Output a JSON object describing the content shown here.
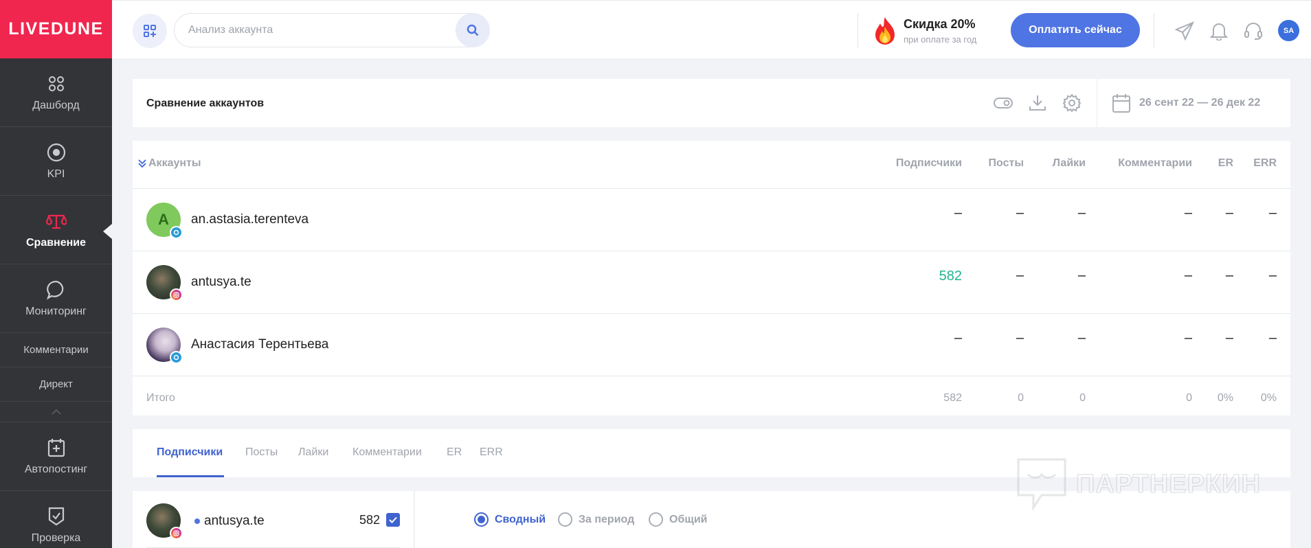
{
  "brand": {
    "name": "LIVEDUNE"
  },
  "sidebar": {
    "items": [
      {
        "label": "Дашборд",
        "icon": "dashboard-icon"
      },
      {
        "label": "KPI",
        "icon": "target-icon"
      },
      {
        "label": "Сравнение",
        "icon": "scales-icon",
        "active": true
      },
      {
        "label": "Мониторинг",
        "icon": "chat-bubble-icon"
      },
      {
        "label": "Комментарии"
      },
      {
        "label": "Директ"
      },
      {
        "label": "Автопостинг",
        "icon": "calendar-plus-icon"
      },
      {
        "label": "Проверка",
        "icon": "check-shield-icon"
      }
    ]
  },
  "header": {
    "search_placeholder": "Анализ аккаунта",
    "promo_title": "Скидка 20%",
    "promo_sub": "при оплате за год",
    "pay_button": "Оплатить сейчас",
    "user_initials": "SA"
  },
  "page": {
    "title": "Сравнение аккаунтов",
    "date_range": "26 сент 22 — 26 дек 22"
  },
  "table": {
    "accounts_header": "Аккаунты",
    "columns": [
      "Подписчики",
      "Посты",
      "Лайки",
      "Комментарии",
      "ER",
      "ERR"
    ],
    "rows": [
      {
        "name": "an.astasia.terenteva",
        "avatar_letter": "A",
        "network": "vk",
        "values": [
          "–",
          "–",
          "–",
          "–",
          "–",
          "–"
        ]
      },
      {
        "name": "antusya.te",
        "network": "instagram",
        "values": [
          "582",
          "–",
          "–",
          "–",
          "–",
          "–"
        ]
      },
      {
        "name": "Анастасия Терентьева",
        "network": "vk",
        "values": [
          "–",
          "–",
          "–",
          "–",
          "–",
          "–"
        ]
      }
    ],
    "total_label": "Итого",
    "totals": [
      "582",
      "0",
      "0",
      "0",
      "0%",
      "0%"
    ]
  },
  "tabs": [
    "Подписчики",
    "Посты",
    "Лайки",
    "Комментарии",
    "ER",
    "ERR"
  ],
  "watermark": "ПАРТНЕРКИН",
  "series": {
    "name": "antusya.te",
    "value": "582"
  },
  "view_modes": [
    "Сводный",
    "За период",
    "Общий"
  ],
  "colors": {
    "brand": "#f0264f",
    "accent": "#4f74e3",
    "positive": "#21b48f",
    "sidebar": "#333437"
  }
}
